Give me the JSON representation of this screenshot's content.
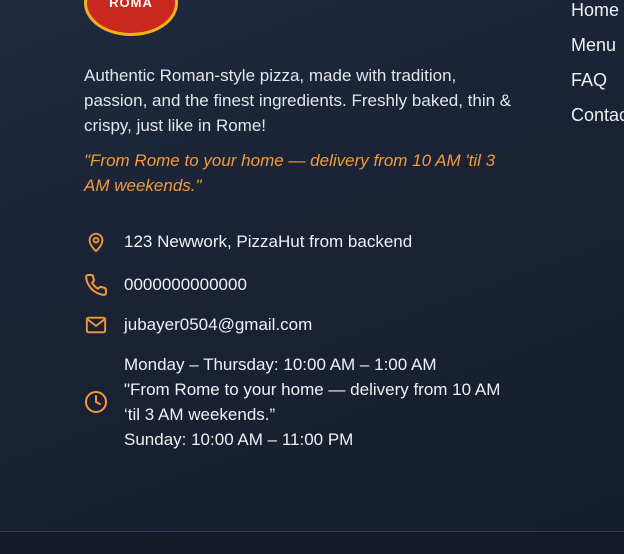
{
  "brand": {
    "logo_text": "ROMA",
    "colors": {
      "accent": "#f39a3a",
      "background": "#1a2234",
      "logo_red": "#c8281e",
      "logo_ring": "#f2b21a"
    }
  },
  "about": {
    "description": "Authentic Roman-style pizza, made with tradition, passion, and the finest ingredients. Freshly baked, thin & crispy, just like in Rome!",
    "tagline": "\"From Rome to your home — delivery from 10 AM 'til 3 AM weekends.\""
  },
  "contact": {
    "address": "123 Newwork, PizzaHut from backend",
    "address_icon": "map-pin-icon",
    "phone": "0000000000000",
    "phone_icon": "phone-icon",
    "email": "jubayer0504@gmail.com",
    "email_icon": "mail-icon",
    "hours_icon": "clock-icon",
    "hours": {
      "weekdays": "Monday – Thursday: 10:00 AM – 1:00 AM",
      "note": "\"From Rome to your home — delivery from 10 AM ‘til 3 AM weekends.”",
      "sunday": "Sunday: 10:00 AM – 11:00 PM"
    }
  },
  "nav": {
    "items": [
      {
        "label": "Home"
      },
      {
        "label": "Menu"
      },
      {
        "label": "FAQ"
      },
      {
        "label": "Contact"
      }
    ]
  }
}
